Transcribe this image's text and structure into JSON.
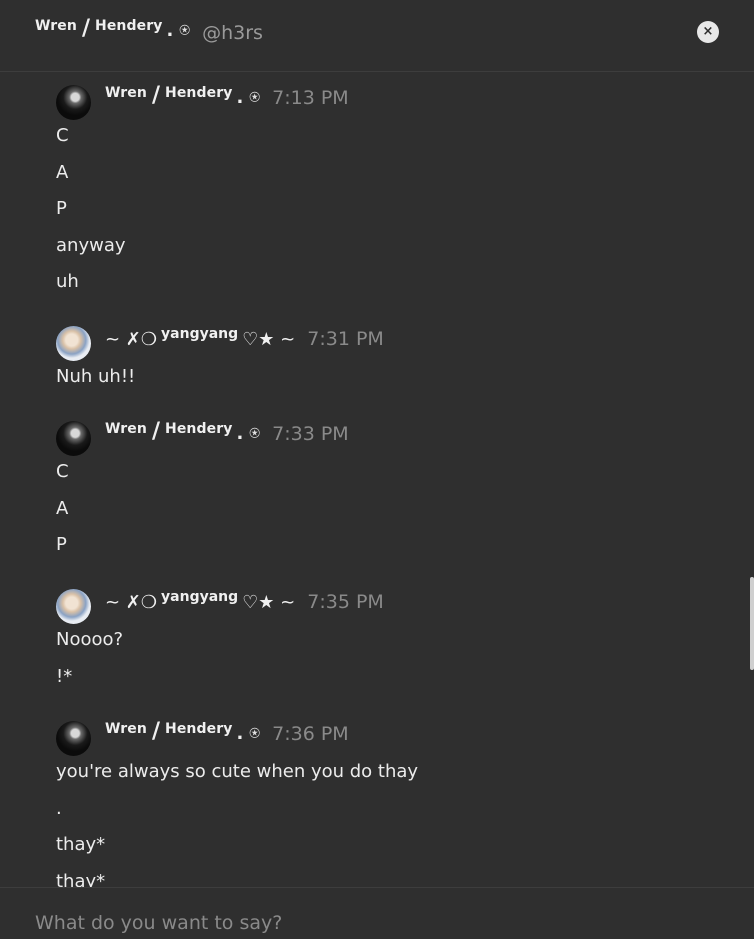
{
  "header": {
    "name_first": "Wren",
    "slash": "/",
    "name_second": "Hendery",
    "dot": ".",
    "star": "⍟",
    "handle": "@h3rs",
    "close_label": "×"
  },
  "messages": [
    {
      "author": {
        "first": "Wren",
        "slash": "/",
        "second": "Hendery",
        "dot": ".",
        "star": "⍟"
      },
      "time": "7:13 PM",
      "lines": [
        "C",
        "A",
        "P",
        "anyway",
        "uh"
      ]
    },
    {
      "author": {
        "pre": "~ ✗❍",
        "name": "yangyang",
        "post": "♡★ ~"
      },
      "time": "7:31 PM",
      "lines": [
        "Nuh uh!!"
      ]
    },
    {
      "author": {
        "first": "Wren",
        "slash": "/",
        "second": "Hendery",
        "dot": ".",
        "star": "⍟"
      },
      "time": "7:33 PM",
      "lines": [
        "C",
        "A",
        "P"
      ]
    },
    {
      "author": {
        "pre": "~ ✗❍",
        "name": "yangyang",
        "post": "♡★ ~"
      },
      "time": "7:35 PM",
      "lines": [
        "Noooo?",
        "!*"
      ]
    },
    {
      "author": {
        "first": "Wren",
        "slash": "/",
        "second": "Hendery",
        "dot": ".",
        "star": "⍟"
      },
      "time": "7:36 PM",
      "lines": [
        "you're always so cute when you do thay",
        ".",
        "thay*",
        "thay*"
      ]
    }
  ],
  "composer": {
    "placeholder": "What do you want to say?"
  }
}
